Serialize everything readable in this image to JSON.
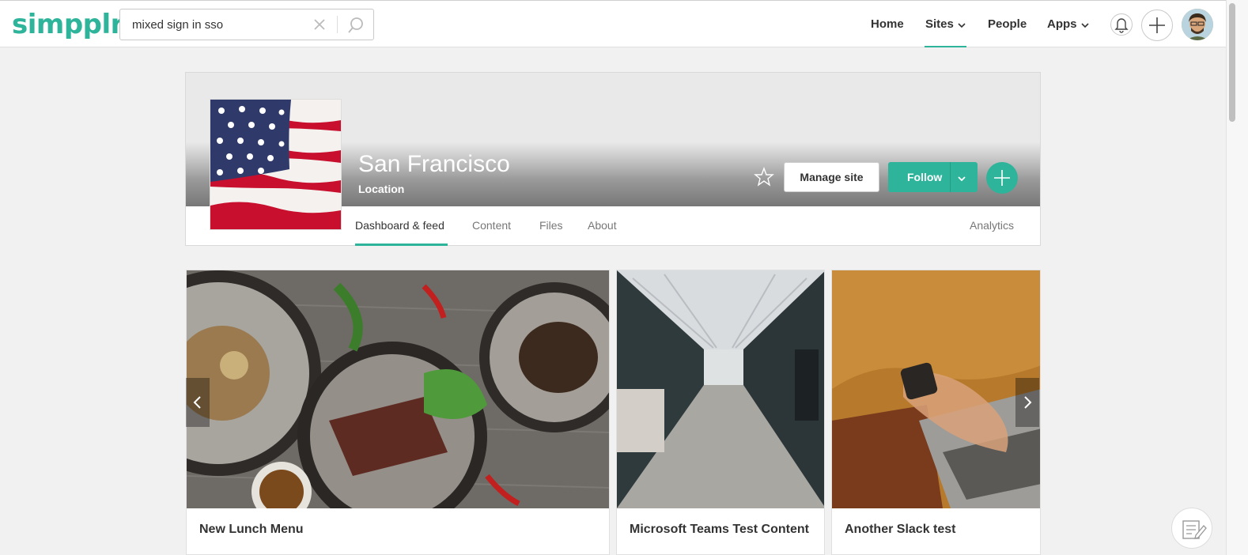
{
  "brand": {
    "logo_text": "simpplr.",
    "accent": "#2db49a"
  },
  "search": {
    "value": "mixed sign in sso"
  },
  "nav": {
    "home": "Home",
    "sites": "Sites",
    "people": "People",
    "apps": "Apps"
  },
  "site": {
    "name": "San Francisco",
    "type": "Location",
    "manage_label": "Manage site",
    "follow_label": "Follow",
    "tabs": [
      "Dashboard & feed",
      "Content",
      "Files",
      "About"
    ],
    "analytics_label": "Analytics"
  },
  "carousel": {
    "cards": [
      {
        "title": "New Lunch Menu"
      },
      {
        "title": "Microsoft Teams Test Content"
      },
      {
        "title": "Another Slack test"
      }
    ]
  },
  "icons": {
    "clear": "close-icon",
    "search": "search-icon",
    "bell": "bell-icon",
    "plus": "plus-icon",
    "star": "star-icon",
    "chevron": "chevron-down-icon",
    "prev": "chevron-left-icon",
    "next": "chevron-right-icon",
    "feedback": "feedback-icon"
  }
}
